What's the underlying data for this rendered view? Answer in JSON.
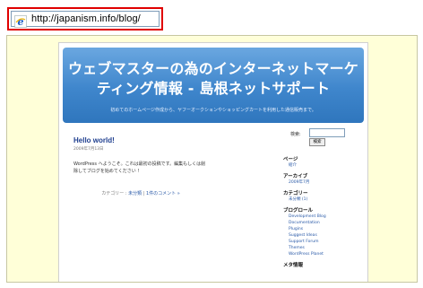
{
  "address_bar": {
    "url": "http://japanism.info/blog/",
    "icon": "ie-icon"
  },
  "blog": {
    "header": {
      "title": "ウェブマスターの為のインターネットマーケティング情報 - 島根ネットサポート",
      "description": "初めてのホームページ作成から、ヤフーオークションやショッピングカートを利用した通信販売まで。"
    },
    "post": {
      "title": "Hello world!",
      "date": "2009年7月13日",
      "body": "WordPress へようこそ。これは最初の投稿です。編集もしくは削除してブログを始めてください !",
      "meta_prefix": "カテゴリー :",
      "meta_category": "未分類",
      "meta_sep": "|",
      "meta_comments": "1件のコメント »"
    },
    "sidebar": {
      "search_label": "検索:",
      "search_value": "",
      "search_button": "検索",
      "sections": [
        {
          "heading": "ページ",
          "links": [
            "紹介"
          ]
        },
        {
          "heading": "アーカイブ",
          "links": [
            "2009年7月"
          ]
        },
        {
          "heading": "カテゴリー",
          "links": [
            "未分類 (1)"
          ]
        },
        {
          "heading": "ブログロール",
          "links": [
            "Development Blog",
            "Documentation",
            "Plugins",
            "Suggest Ideas",
            "Support Forum",
            "Themes",
            "WordPress Planet"
          ]
        },
        {
          "heading": "メタ情報",
          "links": []
        }
      ]
    }
  }
}
